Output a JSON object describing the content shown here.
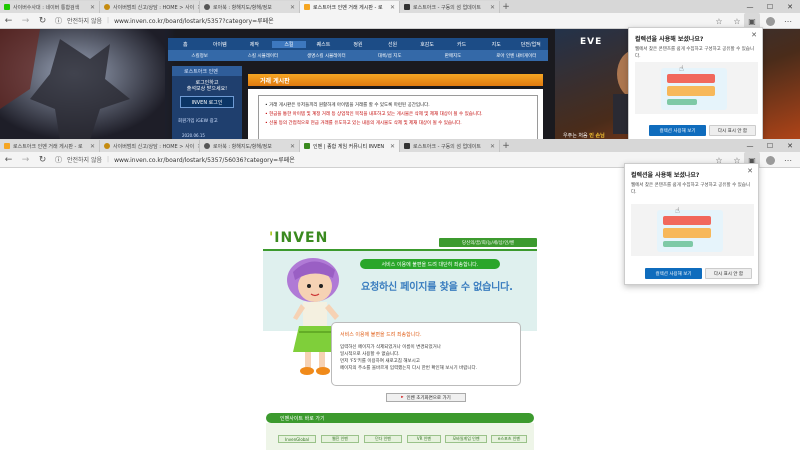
{
  "top_window": {
    "tabs": [
      {
        "label": "사이버수사대 : 네이버 통합검색",
        "color": "#1ec800"
      },
      {
        "label": "사이버범죄 신고/상담 : HOME > 사이",
        "color": "#c58b0f"
      },
      {
        "label": "로아북 : 항해지도/항해/정보",
        "color": "#555555"
      },
      {
        "label": "로스트아크 인벤 거래 게시판 - 로",
        "color": "#f5a623",
        "active": true
      },
      {
        "label": "로스트아크 - 구동의 섬 업데이트",
        "color": "#333333"
      }
    ],
    "insecure_label": "안전하지 않음",
    "url": "www.inven.co.kr/board/lostark/5357?category=루페온",
    "menu": [
      "홈",
      "아이템",
      "제작",
      "스킬",
      "퀘스트",
      "정원",
      "선원",
      "호감도",
      "카드",
      "지도",
      "던전/업적"
    ],
    "menu_active_index": 3,
    "submenu": [
      "스킬정보",
      "스킬 시뮬레이터",
      "생명스킬 시뮬레이터",
      "대륙/섬 지도",
      "판매지도",
      "로아 인벤 내비게이터"
    ],
    "side": {
      "title": "로스트아크 인벤",
      "login_text_1": "로그인하고",
      "login_text_2": "출석보상 받으세요!",
      "login_button": "INVEN 로그인",
      "links": "회원가입   iGEW 광고",
      "date": "2020.06.15"
    },
    "board": {
      "header": "거래 게시판",
      "lines": [
        "• 거래 게시판은 유저들끼리 원활하게 아이템을 거래를 할 수 있도록 마련된 공간입니다.",
        "• 현금을 통한 아이템 및 계정 거래 등 상업적인 목적을 내포하고 있는 게시물은 삭제 및 제재 대상이 될 수 있습니다.",
        "• 선물 등의 간접적으로 현금 거래를 유도하고 있는 내용의 게시물도 삭제 및 제재 대상이 될 수 있습니다."
      ]
    },
    "ad": {
      "logo": "EVE",
      "caption_white": "우주는 처음",
      "caption_gold": "인 손님"
    }
  },
  "bottom_window": {
    "tabs": [
      {
        "label": "로스트아크 인벤 거래 게시판 - 로",
        "color": "#f5a623"
      },
      {
        "label": "사이버범죄 신고/상담 : HOME > 사이",
        "color": "#c58b0f"
      },
      {
        "label": "로아북 : 항해지도/항해/정보",
        "color": "#555555"
      },
      {
        "label": "인벤 | 종합 게임 커뮤니티 INVEN",
        "color": "#3a8a1f",
        "active": true
      },
      {
        "label": "로스트아크 - 구동의 섬 업데이트",
        "color": "#333333"
      }
    ],
    "insecure_label": "안전하지 않음",
    "url": "www.inven.co.kr/board/lostark/5357/56036?category=루페온",
    "page": {
      "logo": "INVEN",
      "top_links": "당신의/꿈/희/능/세/상/인/벤",
      "banner": "서비스 이용에 불편을 드려 대단히 죄송합니다.",
      "big_message": "요청하신 페이지를 찾을 수 없습니다.",
      "box_title": "서비스 이용에 불편을 드려 죄송합니다.",
      "box_lines": [
        "입력하신 페이지가 삭제되었거나 이름이 변경되었거나",
        "일시적으로 사용할 수 없습니다.",
        "먼저 'F5'키를 이용하여 새로고침 해보시고",
        "페이지의 주소를 올바르게 입력했는지 다시 한번 확인해 보시기 바랍니다."
      ],
      "home_button": "인벤 초기화면으로 가기",
      "shortcut_title": "인벤사이트 바로 가기",
      "sites": [
        "InvenGlobal",
        "웹진 인벤",
        "던다 인벤",
        "VR 인벤",
        "모바일게임 인벤",
        "e스포츠 인벤"
      ]
    }
  },
  "popup": {
    "title": "컬렉션을 사용해 보셨나요?",
    "description": "웹에서 찾은 콘텐츠를 쉽게 수집하고 구성하고 공유할 수 있습니다.",
    "primary_button": "컬렉션 사용해 보기",
    "secondary_button": "다시 표시 안 함"
  }
}
